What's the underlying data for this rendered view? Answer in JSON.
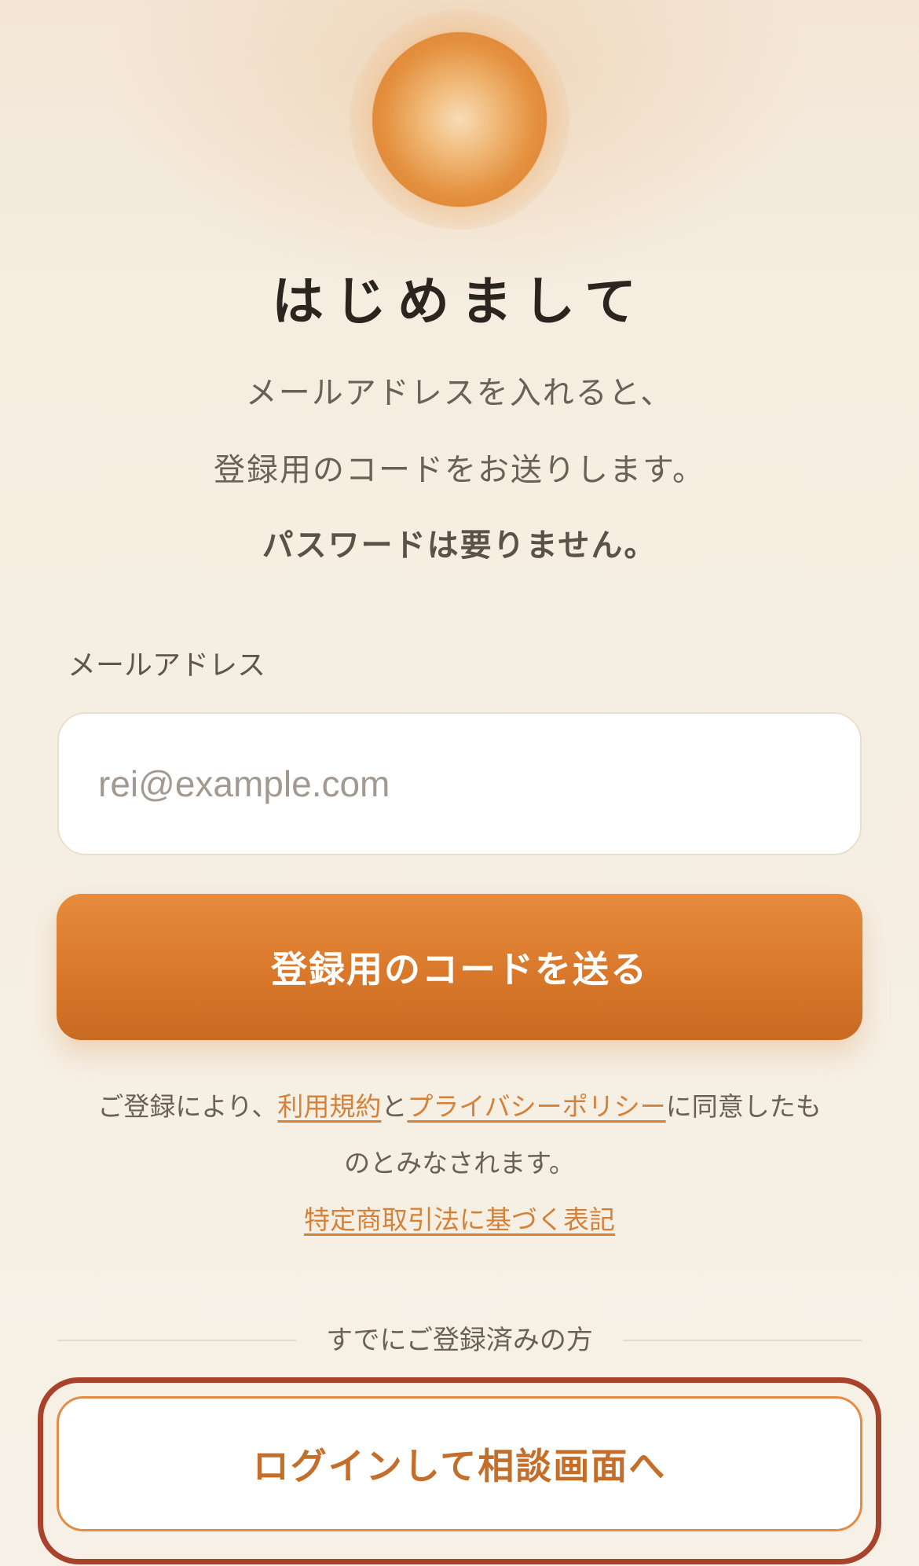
{
  "header": {
    "title": "はじめまして",
    "desc_line1": "メールアドレスを入れると、",
    "desc_line2": "登録用のコードをお送りします。",
    "desc_line3": "パスワードは要りません。"
  },
  "form": {
    "email_label": "メールアドレス",
    "email_placeholder": "rei@example.com",
    "submit_label": "登録用のコードを送る"
  },
  "legal": {
    "prefix": "ご登録により、",
    "terms_link": "利用規約",
    "and": "と",
    "privacy_link": "プライバシーポリシー",
    "suffix": "に同意したも",
    "line2": "のとみなされます。",
    "commerce_link": "特定商取引法に基づく表記"
  },
  "login": {
    "divider_text": "すでにご登録済みの方",
    "button_label": "ログインして相談画面へ"
  },
  "colors": {
    "accent": "#d9782a",
    "focus_ring": "#a8422b",
    "link": "#d4823a"
  }
}
